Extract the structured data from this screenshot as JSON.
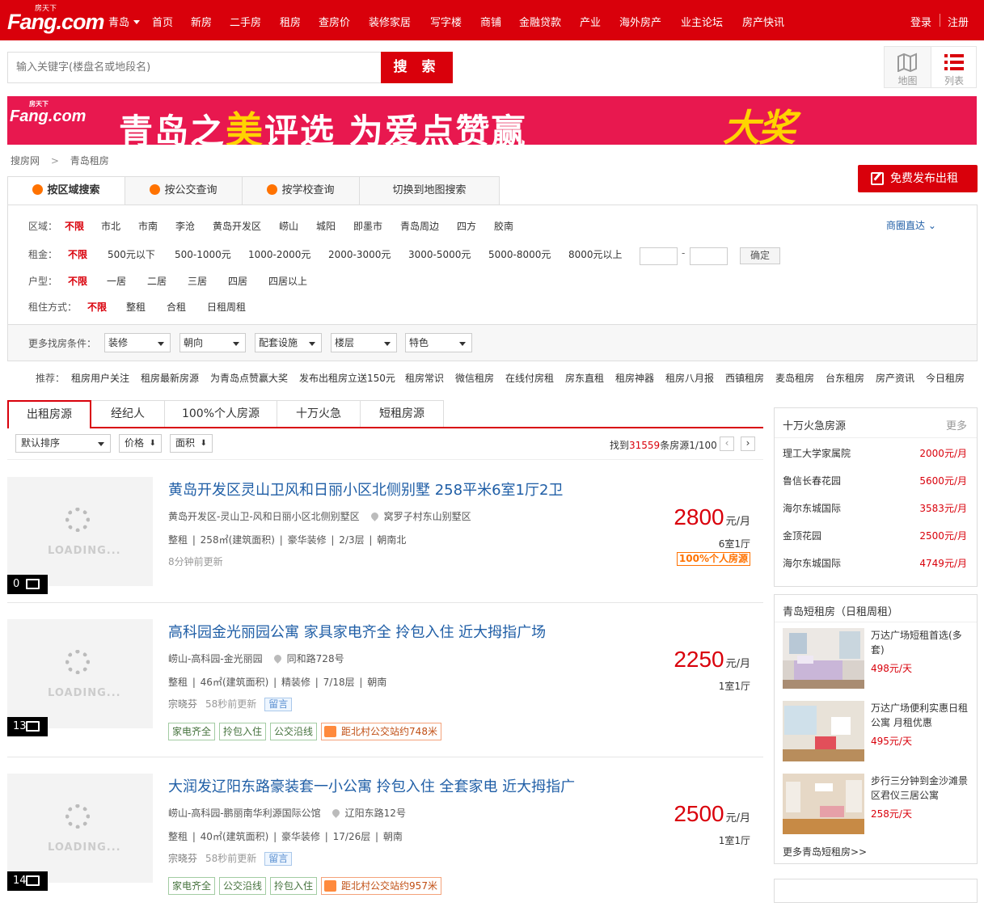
{
  "header": {
    "logo_small": "房天下",
    "logo": "Fang.com",
    "city": "青岛",
    "nav": [
      "首页",
      "新房",
      "二手房",
      "租房",
      "查房价",
      "装修家居",
      "写字楼",
      "商铺",
      "金融贷款",
      "产业",
      "海外房产",
      "业主论坛",
      "房产快讯"
    ],
    "login": "登录",
    "register": "注册"
  },
  "search": {
    "placeholder": "输入关键字(楼盘名或地段名)",
    "button": "搜 索"
  },
  "view_switch": {
    "map": "地图",
    "list": "列表"
  },
  "banner": {
    "logo_small": "房天下",
    "logo": "Fang.com",
    "text_a": "青岛之",
    "text_mei": "美",
    "text_b": "评选  为爱点赞赢",
    "text_big": "大奖"
  },
  "breadcrumb": {
    "home": "搜房网",
    "sep": ">",
    "current": "青岛租房"
  },
  "publish_button": "免费发布出租",
  "search_tabs": [
    "按区域搜索",
    "按公交查询",
    "按学校查询",
    "切换到地图搜索"
  ],
  "filters": {
    "district": {
      "label": "区域：",
      "active": "不限",
      "options": [
        "市北",
        "市南",
        "李沧",
        "黄岛开发区",
        "崂山",
        "城阳",
        "即墨市",
        "青岛周边",
        "四方",
        "胶南"
      ]
    },
    "rent": {
      "label": "租金：",
      "active": "不限",
      "options": [
        "500元以下",
        "500-1000元",
        "1000-2000元",
        "2000-3000元",
        "3000-5000元",
        "5000-8000元",
        "8000元以上"
      ],
      "dash": "-",
      "confirm": "确定"
    },
    "layout": {
      "label": "户型：",
      "active": "不限",
      "options": [
        "一居",
        "二居",
        "三居",
        "四居",
        "四居以上"
      ]
    },
    "mode": {
      "label": "租住方式：",
      "active": "不限",
      "options": [
        "整租",
        "合租",
        "日租周租"
      ]
    },
    "business_district": "商圈直达"
  },
  "more_filters": {
    "label": "更多找房条件：",
    "selects": [
      "装修",
      "朝向",
      "配套设施",
      "楼层",
      "特色"
    ]
  },
  "recommend": {
    "label": "推荐：",
    "links": [
      "租房用户关注",
      "租房最新房源",
      "为青岛点赞赢大奖",
      "发布出租房立送150元",
      "租房常识",
      "微信租房",
      "在线付房租",
      "房东直租",
      "租房神器",
      "租房八月报",
      "西镇租房",
      "麦岛租房",
      "台东租房",
      "房产资讯",
      "今日租房"
    ]
  },
  "list_tabs": [
    "出租房源",
    "经纪人",
    "100%个人房源",
    "十万火急",
    "短租房源"
  ],
  "sort": {
    "default": "默认排序",
    "price": "价格",
    "area": "面积",
    "arrow": "⬇",
    "found_prefix": "找到",
    "found_count": "31559",
    "found_suffix": "条房源1/100",
    "prev": "‹",
    "next": "›"
  },
  "listings": [
    {
      "title": "黄岛开发区灵山卫风和日丽小区北侧别墅 258平米6室1厅2卫",
      "address": "黄岛开发区-灵山卫-风和日丽小区北侧别墅区",
      "street": "窝罗子村东山别墅区",
      "attrs": "整租  |  258㎡(建筑面积)  |  豪华装修  |  2/3层  |  朝南北",
      "time": "8分钟前更新",
      "agent": "",
      "price": "2800",
      "unit": "元/月",
      "rooms": "6室1厅",
      "badge": "100%个人房源",
      "photos": "0",
      "loading": "LOADING...",
      "tags": []
    },
    {
      "title": "高科园金光丽园公寓 家具家电齐全 拎包入住 近大拇指广场",
      "address": "崂山-高科园-金光丽园",
      "street": "同和路728号",
      "attrs": "整租  |  46㎡(建筑面积)  |  精装修  |  7/18层  |  朝南",
      "time": "58秒前更新",
      "agent": "宗晓芬",
      "message": "留言",
      "price": "2250",
      "unit": "元/月",
      "rooms": "1室1厅",
      "badge": "",
      "photos": "13",
      "loading": "LOADING...",
      "tags": [
        "家电齐全",
        "拎包入住",
        "公交沿线"
      ],
      "bus_tag": "距北村公交站约748米"
    },
    {
      "title": "大润发辽阳东路豪装套一小公寓 拎包入住 全套家电 近大拇指广",
      "address": "崂山-高科园-鹏丽南华利源国际公馆",
      "street": "辽阳东路12号",
      "attrs": "整租  |  40㎡(建筑面积)  |  豪华装修  |  17/26层  |  朝南",
      "time": "58秒前更新",
      "agent": "宗晓芬",
      "message": "留言",
      "price": "2500",
      "unit": "元/月",
      "rooms": "1室1厅",
      "badge": "",
      "photos": "14",
      "loading": "LOADING...",
      "tags": [
        "家电齐全",
        "公交沿线",
        "拎包入住"
      ],
      "bus_tag": "距北村公交站约957米"
    }
  ],
  "sidebar_urgent": {
    "title": "十万火急房源",
    "more": "更多",
    "items": [
      {
        "name": "理工大学家属院",
        "price": "2000元/月"
      },
      {
        "name": "鲁信长春花园",
        "price": "5600元/月"
      },
      {
        "name": "海尔东城国际",
        "price": "3583元/月"
      },
      {
        "name": "金顶花园",
        "price": "2500元/月"
      },
      {
        "name": "海尔东城国际",
        "price": "4749元/月"
      }
    ]
  },
  "sidebar_short": {
    "title": "青岛短租房（日租周租）",
    "items": [
      {
        "title": "万达广场短租首选(多套)",
        "price": "498元/天"
      },
      {
        "title": "万达广场便利实惠日租公寓 月租优惠",
        "price": "495元/天"
      },
      {
        "title": "步行三分钟到金沙滩景区君仪三居公寓",
        "price": "258元/天"
      }
    ],
    "more": "更多青岛短租房>>"
  },
  "colors": {
    "brand": "#d9000b",
    "link": "#1f5ea6",
    "accent": "#ff7200"
  }
}
